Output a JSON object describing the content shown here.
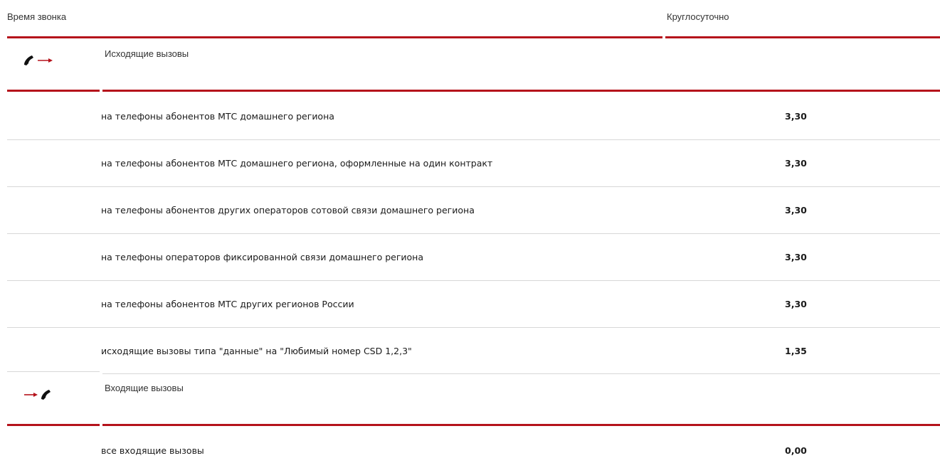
{
  "header": {
    "time_label": "Время звонка",
    "period_label": "Круглосуточно"
  },
  "outgoing": {
    "title": "Исходящие вызовы",
    "icon": "outgoing-call-icon",
    "rows": [
      {
        "label": "на телефоны абонентов МТС домашнего региона",
        "value": "3,30"
      },
      {
        "label": "на телефоны абонентов МТС домашнего региона, оформленные на один контракт",
        "value": "3,30"
      },
      {
        "label": "на телефоны абонентов других операторов сотовой связи домашнего региона",
        "value": "3,30"
      },
      {
        "label": "на телефоны операторов фиксированной связи домашнего региона",
        "value": "3,30"
      },
      {
        "label": "на телефоны абонентов МТС других регионов России",
        "value": "3,30"
      },
      {
        "label": "исходящие вызовы типа \"данные\" на \"Любимый номер CSD 1,2,3\"",
        "value": "1,35"
      }
    ]
  },
  "incoming": {
    "title": "Входящие вызовы",
    "icon": "incoming-call-icon",
    "rows": [
      {
        "label": "все входящие вызовы",
        "value": "0,00"
      }
    ]
  },
  "colors": {
    "accent_red": "#b5121b",
    "divider_grey": "#d7d7d7"
  }
}
